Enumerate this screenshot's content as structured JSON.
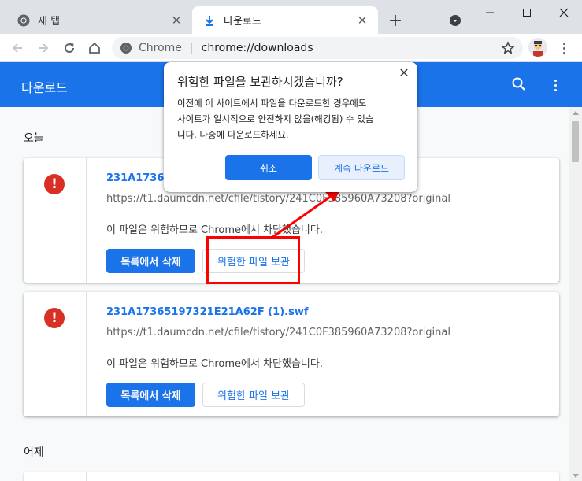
{
  "tabs": [
    {
      "label": "새 탭",
      "icon": "chrome-icon",
      "active": false
    },
    {
      "label": "다운로드",
      "icon": "download-icon",
      "active": true
    }
  ],
  "toolbar": {
    "omnibox_scheme": "Chrome",
    "omnibox_url": "chrome://downloads"
  },
  "header": {
    "title": "다운로드"
  },
  "sections": {
    "today": "오늘",
    "yesterday": "어제"
  },
  "downloads": [
    {
      "filename": "231A173651",
      "url": "https://t1.daumcdn.net/cfile/tistory/241C0F385960A73208?original",
      "status": "이 파일은 위험하므로 Chrome에서 차단했습니다.",
      "remove_label": "목록에서 삭제",
      "keep_label": "위험한 파일 보관"
    },
    {
      "filename": "231A17365197321E21A62F (1).swf",
      "url": "https://t1.daumcdn.net/cfile/tistory/241C0F385960A73208?original",
      "status": "이 파일은 위험하므로 Chrome에서 차단했습니다.",
      "remove_label": "목록에서 삭제",
      "keep_label": "위험한 파일 보관"
    }
  ],
  "dialog": {
    "title": "위험한 파일을 보관하시겠습니까?",
    "message_lines": [
      "이전에 이 사이트에서 파일을 다운로드한 경우에도",
      "사이트가 일시적으로 안전하지 않을(해킹됨) 수 있습",
      "니다. 나중에 다운로드하세요."
    ],
    "cancel_label": "취소",
    "continue_label": "계속 다운로드"
  },
  "colors": {
    "accent": "#1a73e8",
    "danger": "#d93025",
    "annotation": "#ff0000"
  }
}
